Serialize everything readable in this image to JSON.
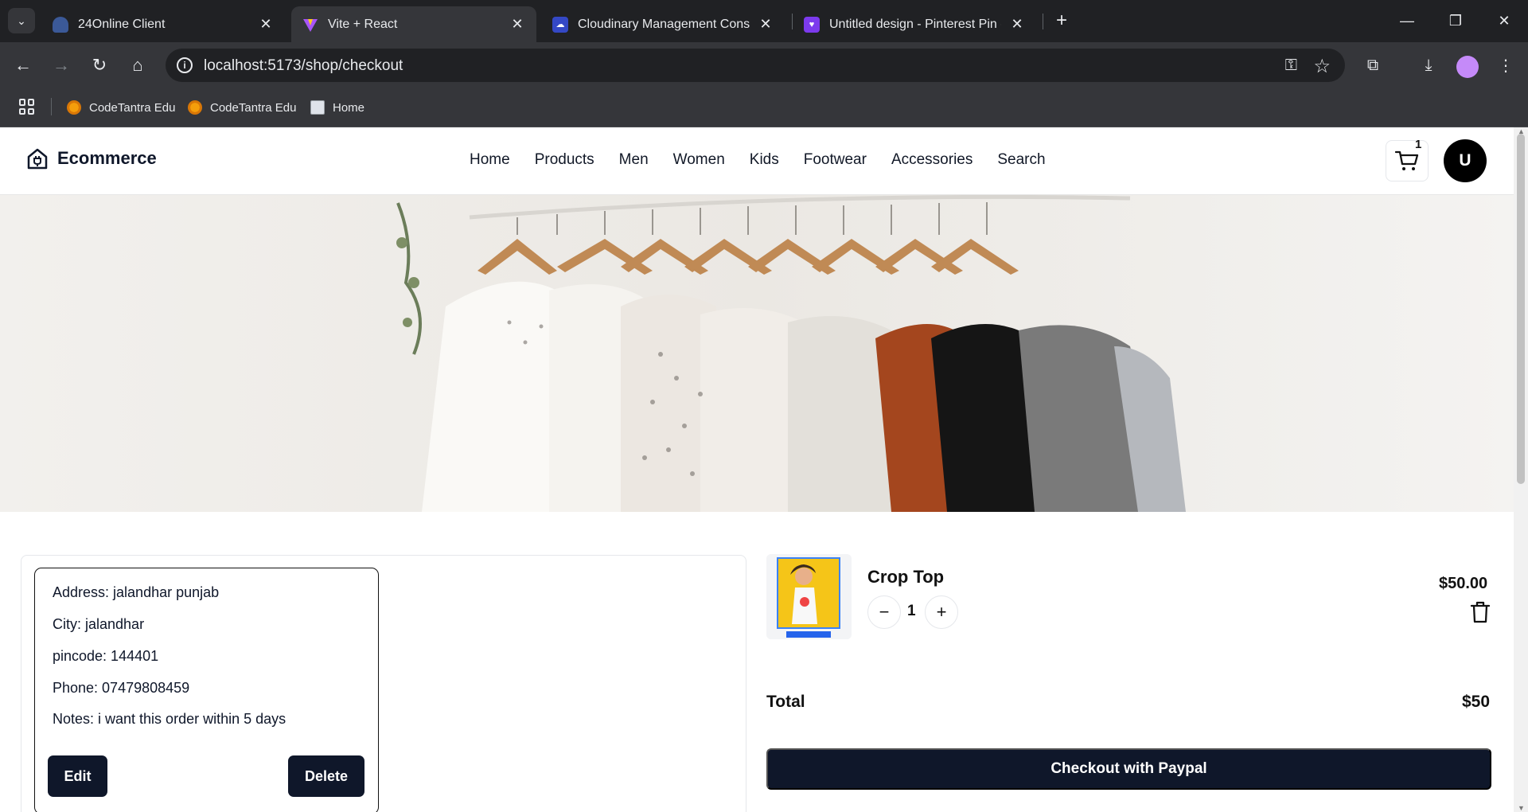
{
  "browser": {
    "tabs": [
      {
        "title": "24Online Client",
        "favicon": "24online-icon",
        "active": false
      },
      {
        "title": "Vite + React",
        "favicon": "vite-icon",
        "active": true
      },
      {
        "title": "Cloudinary Management Console -",
        "favicon": "cloudinary-icon",
        "active": false
      },
      {
        "title": "Untitled design - Pinterest Pin - Ca",
        "favicon": "canva-heart-icon",
        "active": false
      }
    ],
    "url": "localhost:5173/shop/checkout",
    "bookmarks": [
      {
        "label": "CodeTantra Edu"
      },
      {
        "label": "CodeTantra Edu"
      },
      {
        "label": "Home"
      }
    ]
  },
  "site": {
    "brand": "Ecommerce",
    "nav": [
      "Home",
      "Products",
      "Men",
      "Women",
      "Kids",
      "Footwear",
      "Accessories",
      "Search"
    ],
    "cart_count": "1",
    "avatar_initial": "U"
  },
  "address": {
    "lines": [
      "Address: jalandhar punjab",
      "City: jalandhar",
      "pincode: 144401",
      "Phone: 07479808459",
      "Notes: i want this order within 5 days"
    ],
    "edit_label": "Edit",
    "delete_label": "Delete"
  },
  "cart": {
    "item": {
      "title": "Crop Top",
      "quantity": "1",
      "price": "$50.00"
    },
    "total_label": "Total",
    "total_value": "$50",
    "checkout_label": "Checkout with Paypal"
  },
  "colors": {
    "primary": "#0f172a",
    "chrome_dark": "#202124",
    "chrome_mid": "#35363a"
  }
}
